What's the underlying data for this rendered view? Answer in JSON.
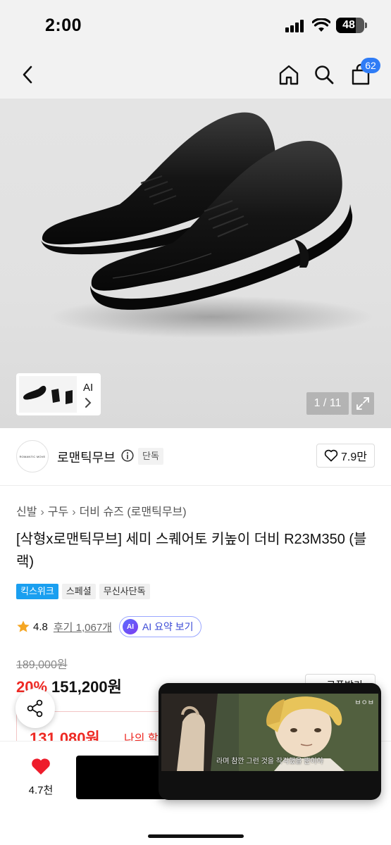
{
  "status_bar": {
    "time": "2:00",
    "battery": "48"
  },
  "nav": {
    "cart_count": "62"
  },
  "gallery": {
    "thumb_label": "AI",
    "counter": "1 / 11"
  },
  "brand": {
    "logo_text": "ROMANTIC MOVE",
    "name": "로맨틱무브",
    "exclusive_tag": "단독",
    "likes": "7.9만"
  },
  "product": {
    "breadcrumb": [
      "신발",
      "구두",
      "더비 슈즈 (로맨틱무브)"
    ],
    "title": "[삭형x로맨틱무브] 세미 스퀘어토 키높이 더비 R23M350 (블랙)",
    "badges": [
      {
        "label": "킥스위크",
        "style": "blue"
      },
      {
        "label": "스페셜",
        "style": "gray"
      },
      {
        "label": "무신사단독",
        "style": "gray"
      }
    ],
    "rating": "4.8",
    "review_link": "후기 1,067개",
    "ai_summary": {
      "icon_text": "AI",
      "label": "AI 요약 보기"
    },
    "original_price": "189,000원",
    "discount_rate": "20%",
    "sale_price": "151,200원",
    "coupon_label": "+ 쿠폰받기",
    "my_price": "131,080원",
    "my_discount_label": "나의 할인"
  },
  "bottom_bar": {
    "wish_count": "4.7천",
    "buy_label": ""
  },
  "pip_video": {
    "watermark": "ㅂㅇㅂ",
    "subtitle": "라며 참깐 그런 것을 착각했을 뿐이야"
  },
  "colors": {
    "accent_blue": "#2f7cf6",
    "sale_red": "#ee2a24",
    "badge_blue": "#1a9ff0",
    "ai_purple": "#5b6cff"
  }
}
